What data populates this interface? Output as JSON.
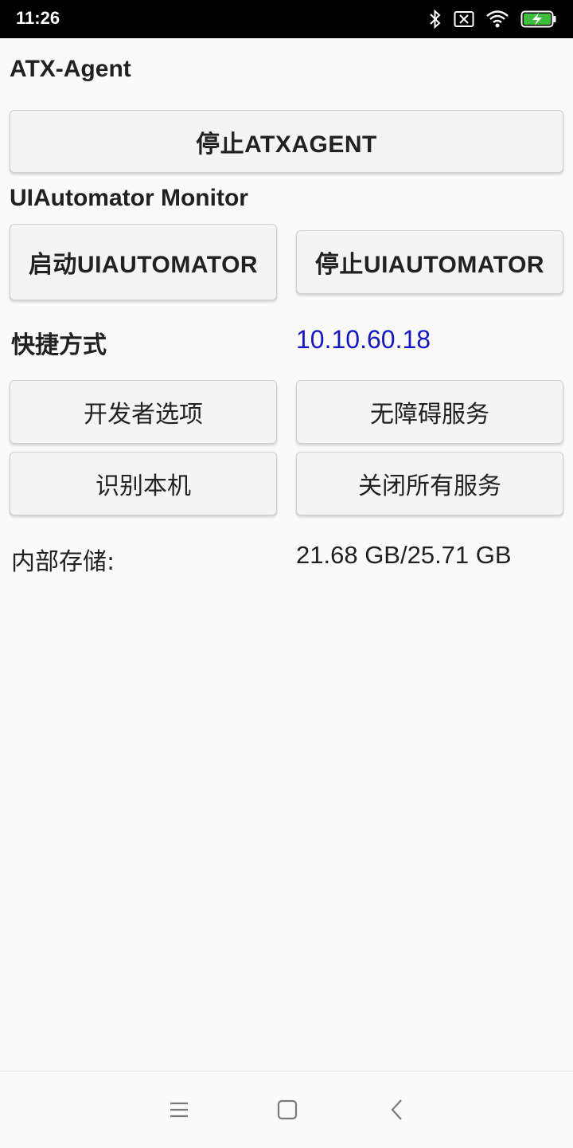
{
  "status_bar": {
    "time": "11:26",
    "icons": [
      "bluetooth-icon",
      "no-sim-icon",
      "wifi-icon",
      "battery-charging-icon"
    ],
    "battery_color": "#3dbd3d"
  },
  "atx_agent": {
    "title": "ATX-Agent",
    "stop_button": "停止ATXAGENT"
  },
  "uiautomator": {
    "title": "UIAutomator Monitor",
    "start_button": "启动UIAUTOMATOR",
    "stop_button": "停止UIAUTOMATOR"
  },
  "shortcuts": {
    "label": "快捷方式",
    "ip": "10.10.60.18",
    "ip_color": "#1515c9",
    "buttons": {
      "developer_options": "开发者选项",
      "accessibility": "无障碍服务",
      "identify_device": "识别本机",
      "close_all_services": "关闭所有服务"
    }
  },
  "storage": {
    "label": "内部存储:",
    "value": "21.68 GB/25.71 GB"
  },
  "nav_bar": {
    "icons": [
      "menu-icon",
      "home-icon",
      "back-icon"
    ]
  }
}
